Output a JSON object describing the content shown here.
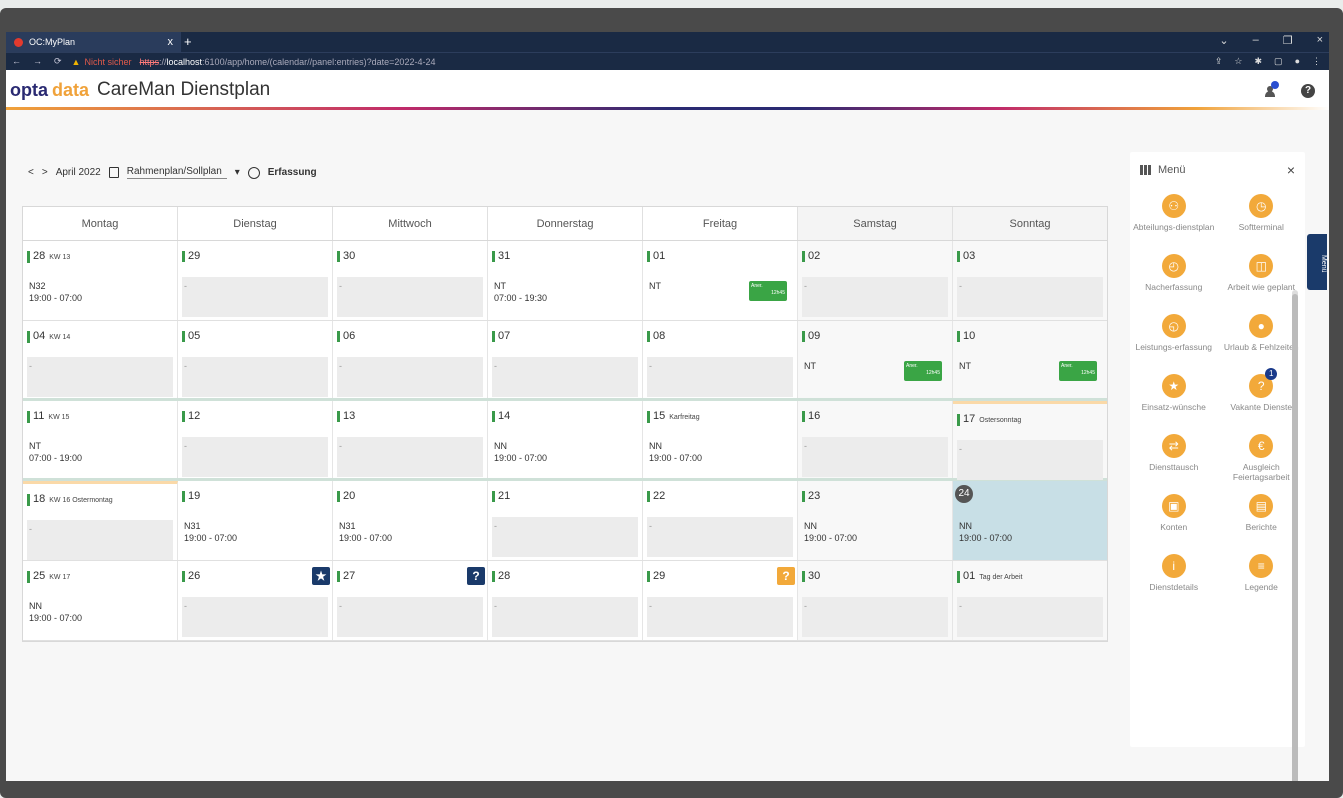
{
  "browser": {
    "tab_title": "OC:MyPlan",
    "tab_close": "x",
    "new_tab": "+",
    "warning": "Nicht sicher",
    "url_scheme": "https",
    "url_host": "localhost",
    "url_rest": ":6100/app/home/(calendar//panel:entries)?date=2022-4-24",
    "window_controls": [
      "⌄",
      "–",
      "❐",
      "×"
    ]
  },
  "header": {
    "logo_part1": "opta",
    "logo_part2": "data",
    "app_title": "CareMan Dienstplan",
    "help_label": "?"
  },
  "toolbar": {
    "prev": "<",
    "next": ">",
    "month": "April 2022",
    "view_select": "Rahmenplan/Sollplan",
    "capture_label": "Erfassung"
  },
  "calendar": {
    "weekdays": [
      "Montag",
      "Dienstag",
      "Mittwoch",
      "Donnerstag",
      "Freitag",
      "Samstag",
      "Sonntag"
    ],
    "weeks": [
      {
        "days": [
          {
            "num": "28",
            "extra": "KW 13",
            "shift": "N32",
            "time": "19:00 - 07:00"
          },
          {
            "num": "29",
            "shift": "-"
          },
          {
            "num": "30",
            "shift": "-"
          },
          {
            "num": "31",
            "shift": "NT",
            "time": "07:00 - 19:30"
          },
          {
            "num": "01",
            "shift": "NT",
            "badge1": "Aner.",
            "badge2": "12h45"
          },
          {
            "num": "02",
            "shift": "-"
          },
          {
            "num": "03",
            "shift": "-"
          }
        ]
      },
      {
        "days": [
          {
            "num": "04",
            "extra": "KW 14",
            "shift": "-"
          },
          {
            "num": "05",
            "shift": "-"
          },
          {
            "num": "06",
            "shift": "-"
          },
          {
            "num": "07",
            "shift": "-"
          },
          {
            "num": "08",
            "shift": "-"
          },
          {
            "num": "09",
            "shift": "NT",
            "badge1": "Aner.",
            "badge2": "12h45"
          },
          {
            "num": "10",
            "shift": "NT",
            "badge1": "Aner.",
            "badge2": "12h45"
          }
        ]
      },
      {
        "days": [
          {
            "num": "11",
            "extra": "KW 15",
            "shift": "NT",
            "time": "07:00 - 19:00"
          },
          {
            "num": "12",
            "shift": "-"
          },
          {
            "num": "13",
            "shift": "-"
          },
          {
            "num": "14",
            "shift": "NN",
            "time": "19:00 - 07:00"
          },
          {
            "num": "15",
            "extra": "Karfreitag",
            "shift": "NN",
            "time": "19:00 - 07:00"
          },
          {
            "num": "16",
            "shift": "-"
          },
          {
            "num": "17",
            "extra": "Ostersonntag",
            "shift": "-"
          }
        ]
      },
      {
        "days": [
          {
            "num": "18",
            "extra": "KW 16 Ostermontag",
            "shift": "-"
          },
          {
            "num": "19",
            "shift": "N31",
            "time": "19:00 - 07:00"
          },
          {
            "num": "20",
            "shift": "N31",
            "time": "19:00 - 07:00"
          },
          {
            "num": "21",
            "shift": "-"
          },
          {
            "num": "22",
            "shift": "-"
          },
          {
            "num": "23",
            "shift": "NN",
            "time": "19:00 - 07:00"
          },
          {
            "num": "24",
            "shift": "NN",
            "time": "19:00 - 07:00"
          }
        ]
      },
      {
        "days": [
          {
            "num": "25",
            "extra": "KW 17",
            "shift": "NN",
            "time": "19:00 - 07:00"
          },
          {
            "num": "26",
            "shift": "-",
            "icon": "★"
          },
          {
            "num": "27",
            "shift": "-",
            "icon": "?"
          },
          {
            "num": "28",
            "shift": "-"
          },
          {
            "num": "29",
            "shift": "-",
            "icon": "?"
          },
          {
            "num": "30",
            "shift": "-"
          },
          {
            "num": "01",
            "extra": "Tag der Arbeit",
            "shift": "-"
          }
        ]
      }
    ]
  },
  "menu": {
    "title": "Menü",
    "close": "×",
    "side_tab": "Menü",
    "items": [
      {
        "label": "Abteilungs-dienstplan",
        "glyph": "⚇"
      },
      {
        "label": "Softterminal",
        "glyph": "◷"
      },
      {
        "label": "Nacherfassung",
        "glyph": "◴"
      },
      {
        "label": "Arbeit wie geplant",
        "glyph": "◫"
      },
      {
        "label": "Leistungs-erfassung",
        "glyph": "◵"
      },
      {
        "label": "Urlaub & Fehlzeiten",
        "glyph": "●"
      },
      {
        "label": "Einsatz-wünsche",
        "glyph": "★"
      },
      {
        "label": "Vakante Dienste",
        "glyph": "?",
        "badge": "1"
      },
      {
        "label": "Diensttausch",
        "glyph": "⇄"
      },
      {
        "label": "Ausgleich Feiertagsarbeit",
        "glyph": "€"
      },
      {
        "label": "Konten",
        "glyph": "▣"
      },
      {
        "label": "Berichte",
        "glyph": "▤"
      },
      {
        "label": "Dienstdetails",
        "glyph": "i"
      },
      {
        "label": "Legende",
        "glyph": "≡"
      }
    ]
  },
  "colors": {
    "accent": "#f2a93a",
    "shift_green": "#3aa545",
    "today": "#c8dfe6"
  }
}
